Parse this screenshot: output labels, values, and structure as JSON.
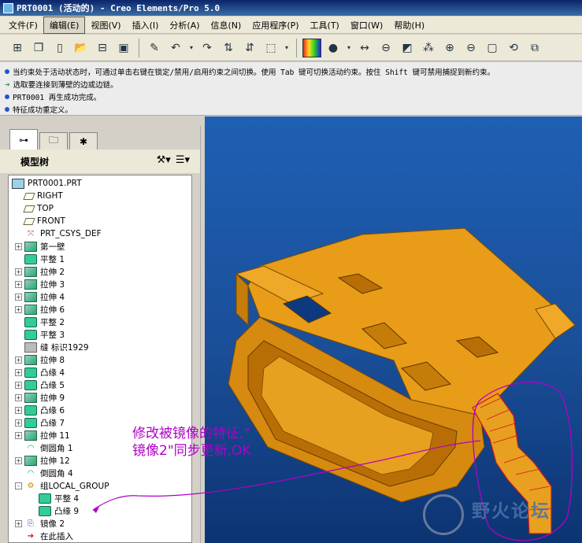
{
  "window": {
    "title": "PRT0001 (活动的) - Creo Elements/Pro 5.0"
  },
  "menu": [
    "文件(F)",
    "编辑(E)",
    "视图(V)",
    "插入(I)",
    "分析(A)",
    "信息(N)",
    "应用程序(P)",
    "工具(T)",
    "窗口(W)",
    "帮助(H)"
  ],
  "messages": [
    {
      "icon": "info",
      "text": "当约束处于活动状态时，可通过单击右键在锁定/禁用/启用约束之间切换。使用 Tab 键可切换活动约束。按住 Shift 键可禁用捕捉到新约束。"
    },
    {
      "icon": "prompt",
      "text": "选取要连接到薄壁的边或边链。"
    },
    {
      "icon": "info",
      "text": "PRT0001 再生成功完成。"
    },
    {
      "icon": "info",
      "text": "特征成功重定义。"
    }
  ],
  "navigator": {
    "heading": "模型树"
  },
  "tree": [
    {
      "label": "PRT0001.PRT",
      "icon": "part",
      "level": 0,
      "expander": ""
    },
    {
      "label": "RIGHT",
      "icon": "plane",
      "level": 1,
      "expander": ""
    },
    {
      "label": "TOP",
      "icon": "plane",
      "level": 1,
      "expander": ""
    },
    {
      "label": "FRONT",
      "icon": "plane",
      "level": 1,
      "expander": ""
    },
    {
      "label": "PRT_CSYS_DEF",
      "icon": "csys",
      "level": 1,
      "expander": ""
    },
    {
      "label": "第一壁",
      "icon": "extrude",
      "level": 1,
      "expander": "+"
    },
    {
      "label": "平整 1",
      "icon": "flat",
      "level": 1,
      "expander": ""
    },
    {
      "label": "拉伸 2",
      "icon": "extrude",
      "level": 1,
      "expander": "+"
    },
    {
      "label": "拉伸 3",
      "icon": "extrude",
      "level": 1,
      "expander": "+"
    },
    {
      "label": "拉伸 4",
      "icon": "extrude",
      "level": 1,
      "expander": "+"
    },
    {
      "label": "拉伸 6",
      "icon": "extrude",
      "level": 1,
      "expander": "+"
    },
    {
      "label": "平整 2",
      "icon": "flat",
      "level": 1,
      "expander": ""
    },
    {
      "label": "平整 3",
      "icon": "flat",
      "level": 1,
      "expander": ""
    },
    {
      "label": "缝 标识1929",
      "icon": "seam",
      "level": 1,
      "expander": ""
    },
    {
      "label": "拉伸 8",
      "icon": "extrude",
      "level": 1,
      "expander": "+"
    },
    {
      "label": "凸缘 4",
      "icon": "flat",
      "level": 1,
      "expander": "+"
    },
    {
      "label": "凸缘 5",
      "icon": "flat",
      "level": 1,
      "expander": "+"
    },
    {
      "label": "拉伸 9",
      "icon": "extrude",
      "level": 1,
      "expander": "+"
    },
    {
      "label": "凸缘 6",
      "icon": "flat",
      "level": 1,
      "expander": "+"
    },
    {
      "label": "凸缘 7",
      "icon": "flat",
      "level": 1,
      "expander": "+"
    },
    {
      "label": "拉伸 11",
      "icon": "extrude",
      "level": 1,
      "expander": "+"
    },
    {
      "label": "倒圆角 1",
      "icon": "round",
      "level": 1,
      "expander": ""
    },
    {
      "label": "拉伸 12",
      "icon": "extrude",
      "level": 1,
      "expander": "+"
    },
    {
      "label": "倒圆角 4",
      "icon": "round",
      "level": 1,
      "expander": ""
    },
    {
      "label": "组LOCAL_GROUP",
      "icon": "group",
      "level": 1,
      "expander": "-"
    },
    {
      "label": "平整 4",
      "icon": "flat",
      "level": 2,
      "expander": ""
    },
    {
      "label": "凸缘 9",
      "icon": "flat",
      "level": 2,
      "expander": ""
    },
    {
      "label": "镜像 2",
      "icon": "mirror",
      "level": 1,
      "expander": "+"
    },
    {
      "label": "在此插入",
      "icon": "insert",
      "level": 1,
      "expander": ""
    }
  ],
  "annotation": {
    "line1": "修改被镜像的特征,\"",
    "line2": "镜像2\"同步更新,OK"
  },
  "watermark": {
    "text": "野火论坛"
  },
  "colors": {
    "part": "#e8a020",
    "annotation": "#b100c8",
    "highlight": "#d01818"
  }
}
